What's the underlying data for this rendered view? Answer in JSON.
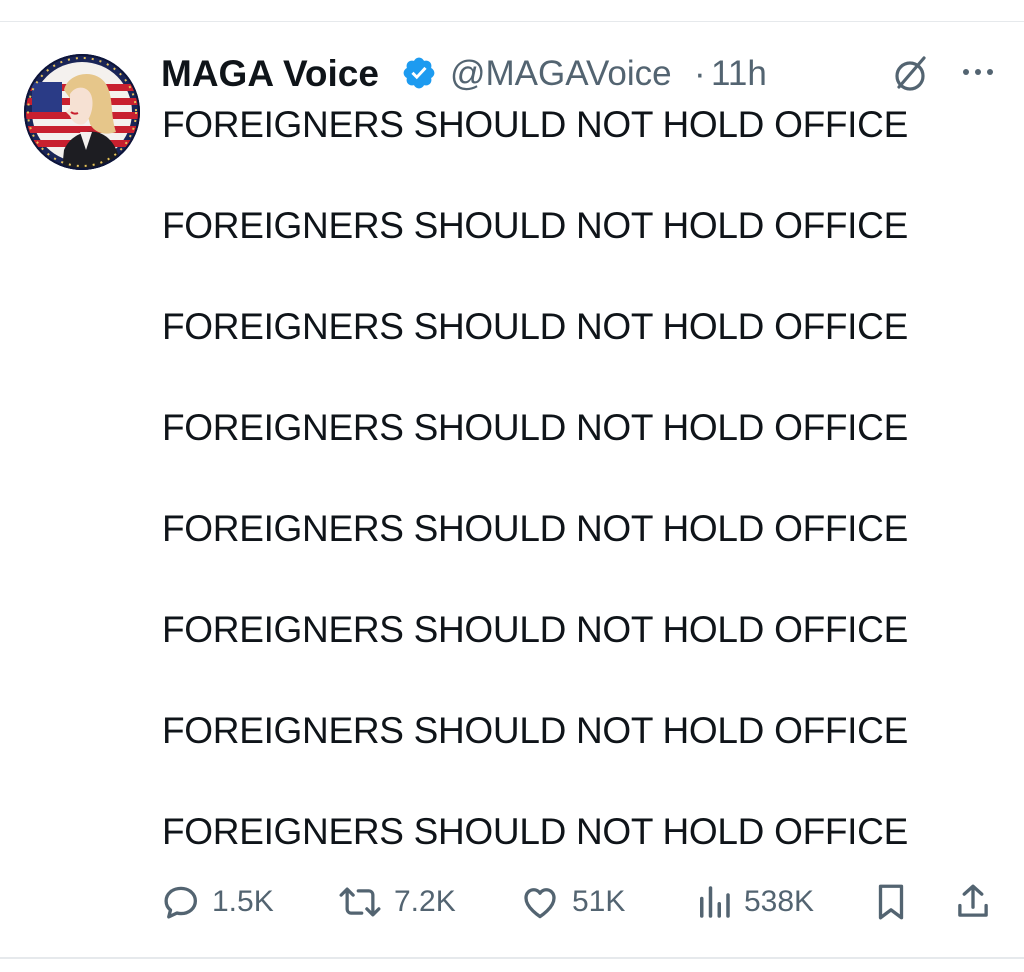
{
  "author": {
    "display_name": "MAGA Voice",
    "handle": "@MAGAVoice",
    "separator": "·",
    "time": "11h",
    "verified": true,
    "verified_color": "#1d9bf0"
  },
  "tweet": {
    "lines": [
      "FOREIGNERS SHOULD NOT HOLD OFFICE",
      "FOREIGNERS SHOULD NOT HOLD OFFICE",
      "FOREIGNERS SHOULD NOT HOLD OFFICE",
      "FOREIGNERS SHOULD NOT HOLD OFFICE",
      "FOREIGNERS SHOULD NOT HOLD OFFICE",
      "FOREIGNERS SHOULD NOT HOLD OFFICE",
      "FOREIGNERS SHOULD NOT HOLD OFFICE",
      "FOREIGNERS SHOULD NOT HOLD OFFICE"
    ]
  },
  "actions": {
    "replies": "1.5K",
    "reposts": "7.2K",
    "likes": "51K",
    "views": "538K"
  },
  "icons": {
    "reply": "reply-icon",
    "repost": "repost-icon",
    "like": "heart-icon",
    "views": "views-icon",
    "bookmark": "bookmark-icon",
    "share": "share-icon",
    "grok": "grok-icon",
    "more": "more-icon",
    "verified": "verified-badge-icon"
  },
  "colors": {
    "text": "#0f1419",
    "secondary": "#536471",
    "accent": "#1d9bf0"
  }
}
